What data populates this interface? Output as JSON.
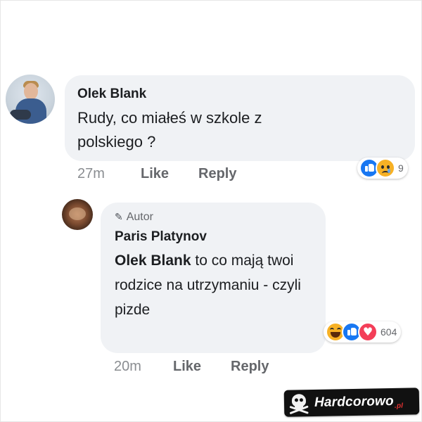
{
  "comments": [
    {
      "author": "Olek Blank",
      "text": "Rudy, co miałeś w szkole z polskiego ?",
      "time": "27m",
      "like_label": "Like",
      "reply_label": "Reply",
      "reaction_icons": [
        "like-icon",
        "sad-icon"
      ],
      "reaction_count": "9"
    }
  ],
  "reply": {
    "badge_label": "Autor",
    "badge_icon": "pencil-icon",
    "author": "Paris Platynov",
    "mention": "Olek Blank",
    "text": " to co mają twoi rodzice na utrzymaniu - czyli pizde",
    "time": "20m",
    "like_label": "Like",
    "reply_label": "Reply",
    "reaction_icons": [
      "haha-icon",
      "like-icon",
      "love-icon"
    ],
    "reaction_count": "604"
  },
  "watermark": {
    "text": "Hardcorowo",
    "suffix": ".pl",
    "icon": "skull-icon"
  },
  "colors": {
    "bubble": "#f0f2f5",
    "meta_text": "#65676b",
    "like_blue": "#1877f2",
    "love_red": "#f33e58",
    "emoji_yellow": "#f7b125"
  }
}
